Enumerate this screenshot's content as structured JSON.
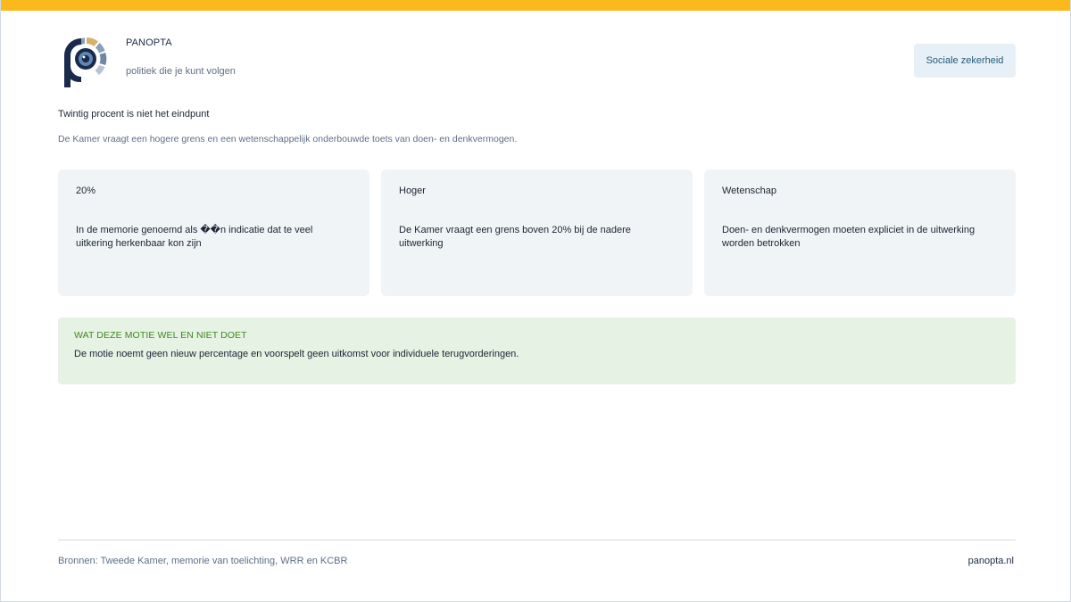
{
  "brand": {
    "name": "PANOPTA",
    "tagline": "politiek die je kunt volgen",
    "logo_icon": "panopta-eye-logo"
  },
  "topic": {
    "label": "Sociale zekerheid"
  },
  "intro": {
    "headline": "Twintig procent is niet het eindpunt",
    "subline": "De Kamer vraagt een hogere grens en een wetenschappelijk onderbouwde toets van doen- en denkvermogen."
  },
  "cards": [
    {
      "title": "20%",
      "body": "In de memorie genoemd als ��n indicatie dat te veel uitkering herkenbaar kon zijn"
    },
    {
      "title": "Hoger",
      "body": "De Kamer vraagt een grens boven 20% bij de nadere uitwerking"
    },
    {
      "title": "Wetenschap",
      "body": "Doen- en denkvermogen moeten expliciet in de uitwerking worden betrokken"
    }
  ],
  "note": {
    "label": "WAT DEZE MOTIE WEL EN NIET DOET",
    "text": "De motie noemt geen nieuw percentage en voorspelt geen uitkomst voor individuele terugvorderingen."
  },
  "footer": {
    "sources": "Bronnen: Tweede Kamer, memorie van toelichting, WRR en KCBR",
    "site": "panopta.nl"
  },
  "colors": {
    "accent_bar": "#fbb91e",
    "card_bg": "#f0f4f7",
    "note_bg": "#e6f2e4",
    "note_label": "#3d8a1e",
    "badge_bg": "#e7f0f6"
  }
}
